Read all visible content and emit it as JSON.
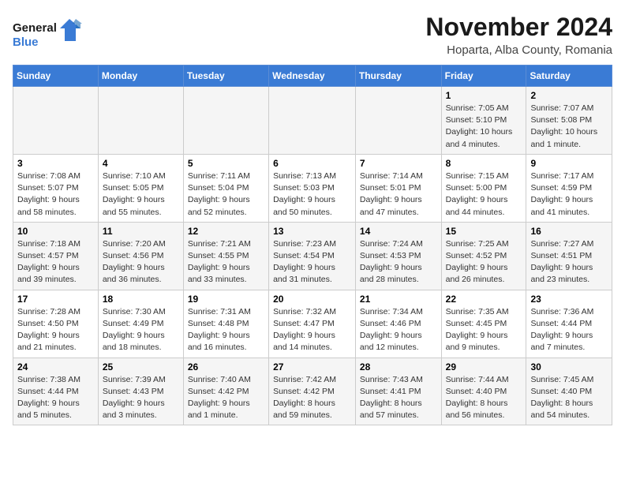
{
  "logo": {
    "line1": "General",
    "line2": "Blue"
  },
  "title": "November 2024",
  "subtitle": "Hoparta, Alba County, Romania",
  "weekdays": [
    "Sunday",
    "Monday",
    "Tuesday",
    "Wednesday",
    "Thursday",
    "Friday",
    "Saturday"
  ],
  "weeks": [
    [
      {
        "day": "",
        "info": ""
      },
      {
        "day": "",
        "info": ""
      },
      {
        "day": "",
        "info": ""
      },
      {
        "day": "",
        "info": ""
      },
      {
        "day": "",
        "info": ""
      },
      {
        "day": "1",
        "info": "Sunrise: 7:05 AM\nSunset: 5:10 PM\nDaylight: 10 hours and 4 minutes."
      },
      {
        "day": "2",
        "info": "Sunrise: 7:07 AM\nSunset: 5:08 PM\nDaylight: 10 hours and 1 minute."
      }
    ],
    [
      {
        "day": "3",
        "info": "Sunrise: 7:08 AM\nSunset: 5:07 PM\nDaylight: 9 hours and 58 minutes."
      },
      {
        "day": "4",
        "info": "Sunrise: 7:10 AM\nSunset: 5:05 PM\nDaylight: 9 hours and 55 minutes."
      },
      {
        "day": "5",
        "info": "Sunrise: 7:11 AM\nSunset: 5:04 PM\nDaylight: 9 hours and 52 minutes."
      },
      {
        "day": "6",
        "info": "Sunrise: 7:13 AM\nSunset: 5:03 PM\nDaylight: 9 hours and 50 minutes."
      },
      {
        "day": "7",
        "info": "Sunrise: 7:14 AM\nSunset: 5:01 PM\nDaylight: 9 hours and 47 minutes."
      },
      {
        "day": "8",
        "info": "Sunrise: 7:15 AM\nSunset: 5:00 PM\nDaylight: 9 hours and 44 minutes."
      },
      {
        "day": "9",
        "info": "Sunrise: 7:17 AM\nSunset: 4:59 PM\nDaylight: 9 hours and 41 minutes."
      }
    ],
    [
      {
        "day": "10",
        "info": "Sunrise: 7:18 AM\nSunset: 4:57 PM\nDaylight: 9 hours and 39 minutes."
      },
      {
        "day": "11",
        "info": "Sunrise: 7:20 AM\nSunset: 4:56 PM\nDaylight: 9 hours and 36 minutes."
      },
      {
        "day": "12",
        "info": "Sunrise: 7:21 AM\nSunset: 4:55 PM\nDaylight: 9 hours and 33 minutes."
      },
      {
        "day": "13",
        "info": "Sunrise: 7:23 AM\nSunset: 4:54 PM\nDaylight: 9 hours and 31 minutes."
      },
      {
        "day": "14",
        "info": "Sunrise: 7:24 AM\nSunset: 4:53 PM\nDaylight: 9 hours and 28 minutes."
      },
      {
        "day": "15",
        "info": "Sunrise: 7:25 AM\nSunset: 4:52 PM\nDaylight: 9 hours and 26 minutes."
      },
      {
        "day": "16",
        "info": "Sunrise: 7:27 AM\nSunset: 4:51 PM\nDaylight: 9 hours and 23 minutes."
      }
    ],
    [
      {
        "day": "17",
        "info": "Sunrise: 7:28 AM\nSunset: 4:50 PM\nDaylight: 9 hours and 21 minutes."
      },
      {
        "day": "18",
        "info": "Sunrise: 7:30 AM\nSunset: 4:49 PM\nDaylight: 9 hours and 18 minutes."
      },
      {
        "day": "19",
        "info": "Sunrise: 7:31 AM\nSunset: 4:48 PM\nDaylight: 9 hours and 16 minutes."
      },
      {
        "day": "20",
        "info": "Sunrise: 7:32 AM\nSunset: 4:47 PM\nDaylight: 9 hours and 14 minutes."
      },
      {
        "day": "21",
        "info": "Sunrise: 7:34 AM\nSunset: 4:46 PM\nDaylight: 9 hours and 12 minutes."
      },
      {
        "day": "22",
        "info": "Sunrise: 7:35 AM\nSunset: 4:45 PM\nDaylight: 9 hours and 9 minutes."
      },
      {
        "day": "23",
        "info": "Sunrise: 7:36 AM\nSunset: 4:44 PM\nDaylight: 9 hours and 7 minutes."
      }
    ],
    [
      {
        "day": "24",
        "info": "Sunrise: 7:38 AM\nSunset: 4:44 PM\nDaylight: 9 hours and 5 minutes."
      },
      {
        "day": "25",
        "info": "Sunrise: 7:39 AM\nSunset: 4:43 PM\nDaylight: 9 hours and 3 minutes."
      },
      {
        "day": "26",
        "info": "Sunrise: 7:40 AM\nSunset: 4:42 PM\nDaylight: 9 hours and 1 minute."
      },
      {
        "day": "27",
        "info": "Sunrise: 7:42 AM\nSunset: 4:42 PM\nDaylight: 8 hours and 59 minutes."
      },
      {
        "day": "28",
        "info": "Sunrise: 7:43 AM\nSunset: 4:41 PM\nDaylight: 8 hours and 57 minutes."
      },
      {
        "day": "29",
        "info": "Sunrise: 7:44 AM\nSunset: 4:40 PM\nDaylight: 8 hours and 56 minutes."
      },
      {
        "day": "30",
        "info": "Sunrise: 7:45 AM\nSunset: 4:40 PM\nDaylight: 8 hours and 54 minutes."
      }
    ]
  ]
}
